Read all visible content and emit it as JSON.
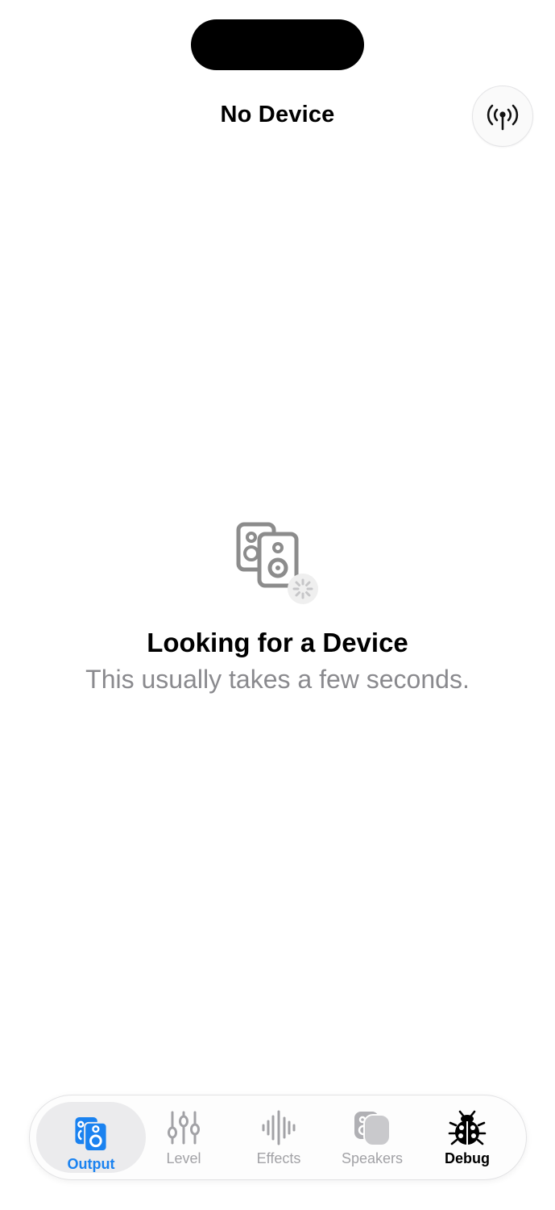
{
  "header": {
    "title": "No Device",
    "broadcast_icon": "antenna-broadcast-icon"
  },
  "empty_state": {
    "icon": "speakers-searching-icon",
    "title": "Looking for a Device",
    "subtitle": "This usually takes a few seconds."
  },
  "tabbar": {
    "tabs": [
      {
        "label": "Output",
        "icon": "speaker-icon",
        "state": "selected"
      },
      {
        "label": "Level",
        "icon": "sliders-icon",
        "state": "disabled"
      },
      {
        "label": "Effects",
        "icon": "waveform-icon",
        "state": "disabled"
      },
      {
        "label": "Speakers",
        "icon": "homepod-icon",
        "state": "disabled"
      },
      {
        "label": "Debug",
        "icon": "ladybug-icon",
        "state": "enabled"
      }
    ]
  },
  "colors": {
    "accent": "#1a82f0",
    "disabled": "#a2a2a6",
    "subtitle": "#8a8a8e"
  }
}
